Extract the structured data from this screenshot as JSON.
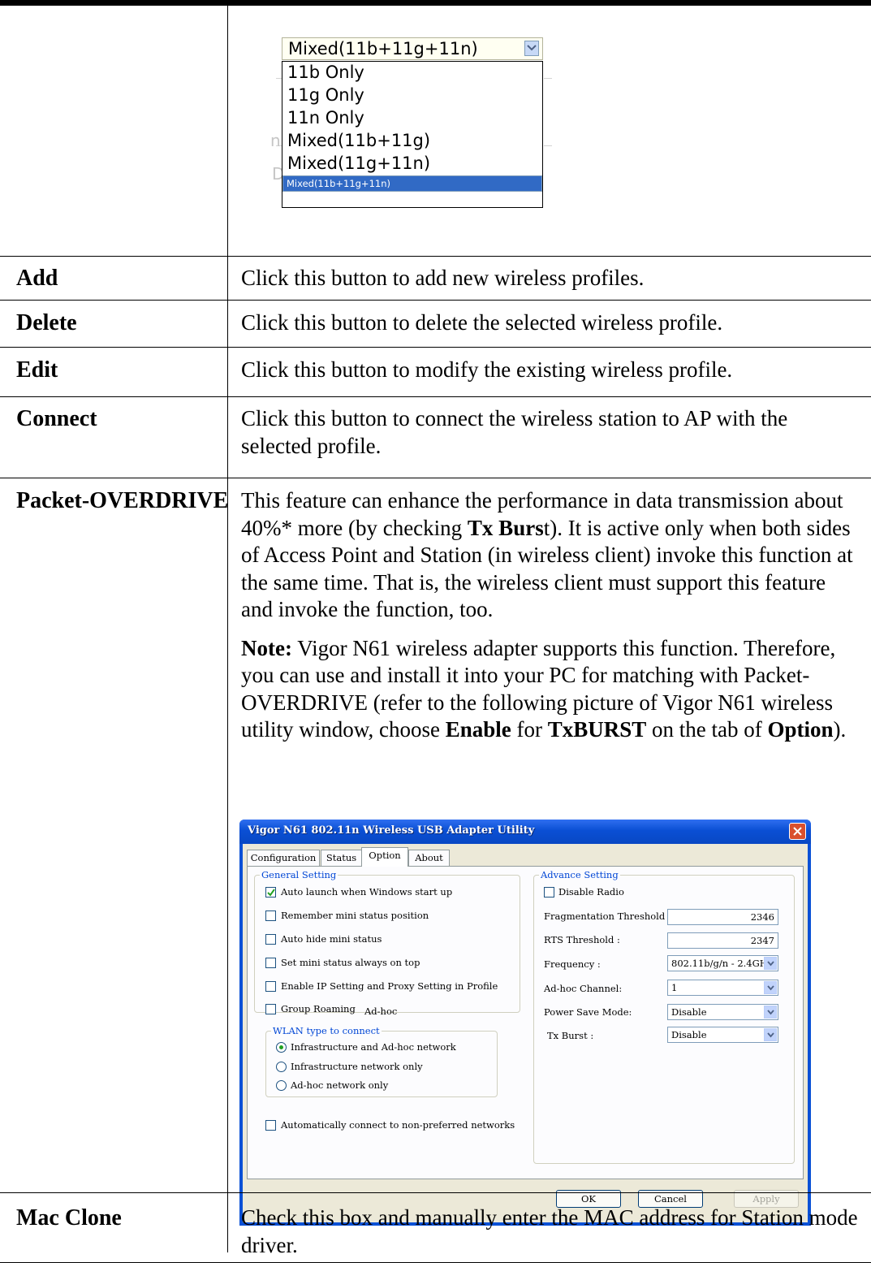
{
  "dropdown_image": {
    "selected_value": "Mixed(11b+11g+11n)",
    "options": [
      "11b Only",
      "11g Only",
      "11n Only",
      "Mixed(11b+11g)",
      "Mixed(11g+11n)",
      "Mixed(11b+11g+11n)"
    ],
    "highlighted_option": "Mixed(11b+11g+11n)"
  },
  "rows": {
    "add": {
      "term": "Add",
      "desc": "Click this button to add new wireless profiles."
    },
    "delete": {
      "term": "Delete",
      "desc": "Click this button to delete the selected wireless profile."
    },
    "edit": {
      "term": "Edit",
      "desc": "Click this button to modify the existing wireless profile."
    },
    "connect": {
      "term": "Connect",
      "desc": "Click this button to connect the wireless station to AP with the selected profile."
    },
    "packet": {
      "term": "Packet-OVERDRIVE",
      "p1_a": "This feature can enhance the performance in data transmission about 40%* more (by checking ",
      "p1_b1": "Tx Burs",
      "p1_c": "t). It is active only when both sides of Access Point and Station (in wireless client) invoke this function at the same time. That is, the wireless client must support this feature and invoke the function, too.",
      "note_label": "Note:",
      "p2_a": " Vigor N61 wireless adapter supports this function. Therefore, you can use and install it into your PC for matching with Packet-OVERDRIVE (refer to the following picture of Vigor N61 wireless utility window, choose ",
      "p2_b1": "Enable",
      "p2_c": " for ",
      "p2_b2": "TxBURST",
      "p2_d": " on the tab of ",
      "p2_b3": "Option",
      "p2_e": ")."
    },
    "mac": {
      "term": "Mac Clone",
      "desc": "Check this box and manually enter the MAC address for Station mode driver."
    }
  },
  "utility_window": {
    "title": "Vigor N61 802.11n Wireless USB Adapter Utility",
    "tabs": [
      "Configuration",
      "Status",
      "Option",
      "About"
    ],
    "active_tab": "Option",
    "general_setting": {
      "label": "General Setting",
      "items": [
        {
          "label": "Auto launch when Windows start up",
          "checked": true
        },
        {
          "label": "Remember mini status position",
          "checked": false
        },
        {
          "label": "Auto hide mini status",
          "checked": false
        },
        {
          "label": "Set mini status always on top",
          "checked": false
        },
        {
          "label": "Enable IP Setting and Proxy Setting in Profile",
          "checked": false
        },
        {
          "label": "Group Roaming",
          "checked": false
        }
      ],
      "adhoc_text": "Ad-hoc"
    },
    "wlan_type": {
      "label": "WLAN type to connect",
      "options": [
        "Infrastructure and Ad-hoc network",
        "Infrastructure network only",
        "Ad-hoc network only"
      ],
      "selected": "Infrastructure and Ad-hoc network"
    },
    "auto_connect": {
      "label": "Automatically connect to non-preferred networks",
      "checked": false
    },
    "advance_setting": {
      "label": "Advance Setting",
      "disable_radio": {
        "label": "Disable Radio",
        "checked": false
      },
      "frag_label": "Fragmentation Threshold :",
      "frag_value": "2346",
      "rts_label": "RTS Threshold :",
      "rts_value": "2347",
      "freq_label": "Frequency :",
      "freq_value": "802.11b/g/n - 2.4GH",
      "channel_label": "Ad-hoc Channel:",
      "channel_value": "1",
      "psm_label": "Power Save Mode:",
      "psm_value": "Disable",
      "txburst_label": "Tx Burst :",
      "txburst_value": "Disable"
    },
    "buttons": {
      "ok": "OK",
      "cancel": "Cancel",
      "apply": "Apply"
    }
  }
}
